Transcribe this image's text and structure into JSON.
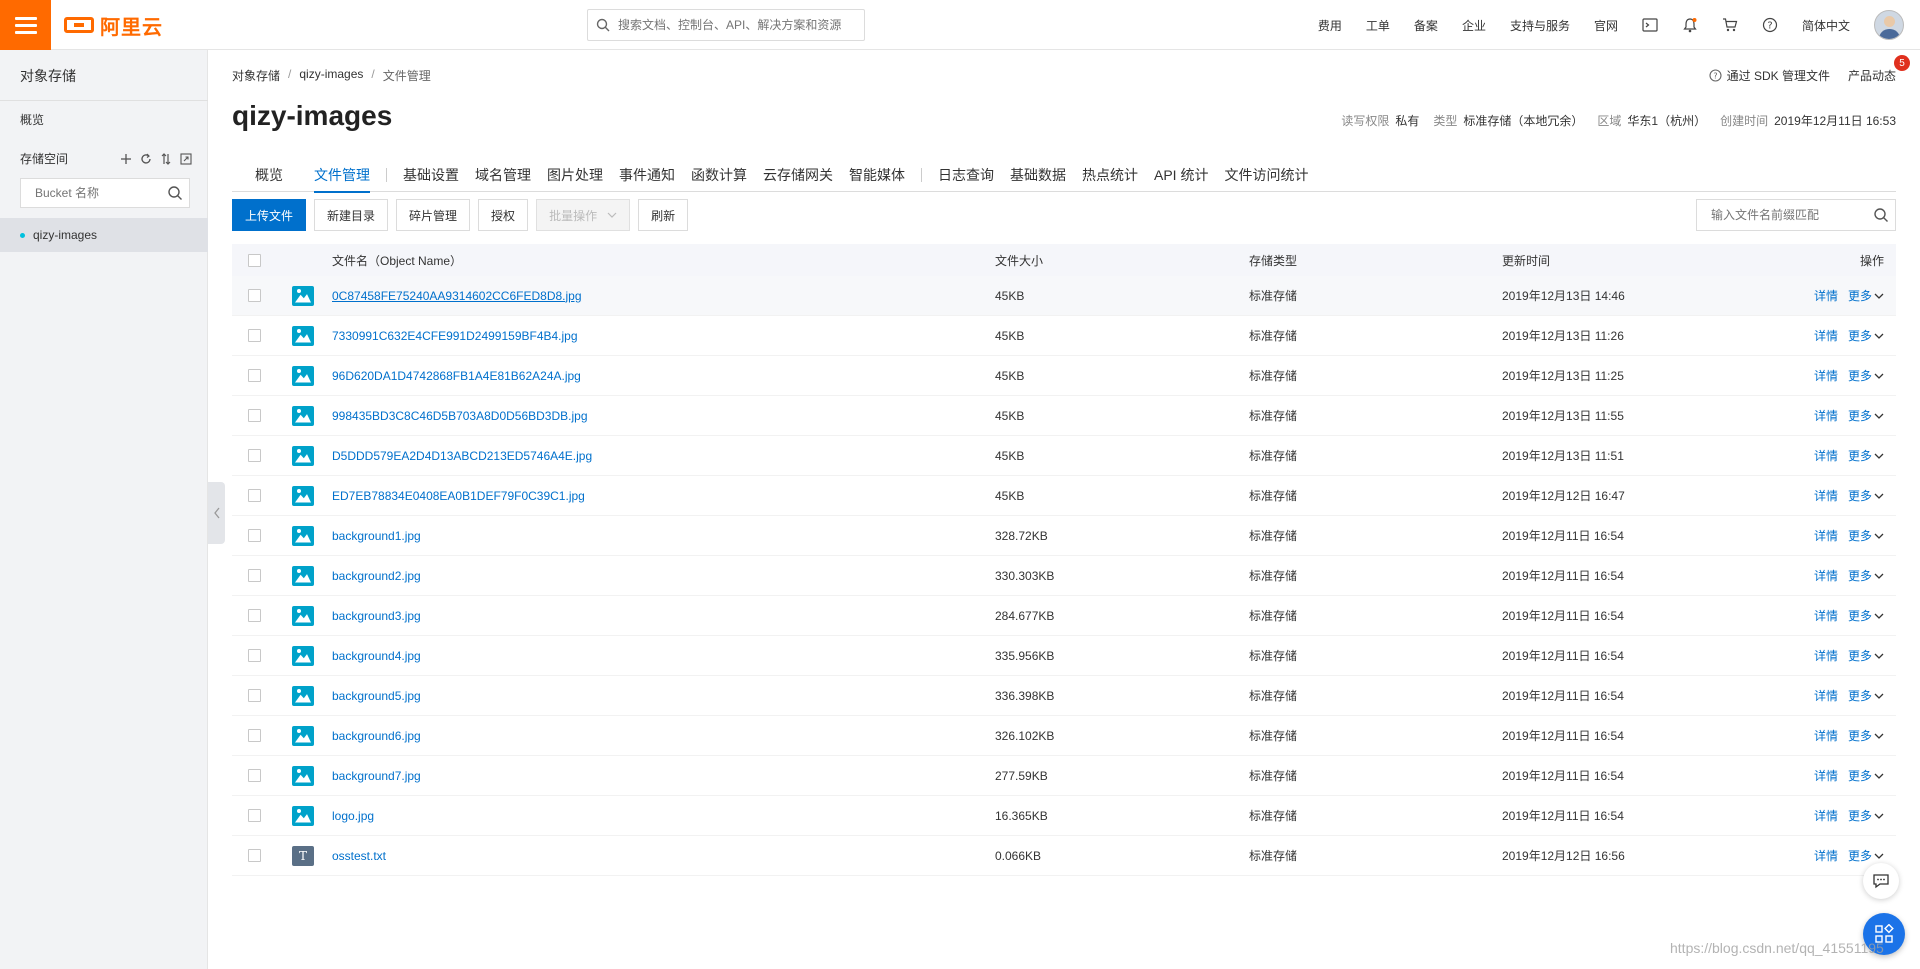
{
  "topbar": {
    "logo_text": "阿里云",
    "search_placeholder": "搜索文档、控制台、API、解决方案和资源",
    "nav": [
      "费用",
      "工单",
      "备案",
      "企业",
      "支持与服务",
      "官网"
    ],
    "language": "简体中文",
    "brand_color": "#ff6a00"
  },
  "sidebar": {
    "title": "对象存储",
    "overview": "概览",
    "buckets_label": "存储空间",
    "bucket_search_placeholder": "Bucket 名称",
    "active_bucket": "qizy-images"
  },
  "breadcrumb": [
    "对象存储",
    "qizy-images",
    "文件管理"
  ],
  "page_title": "qizy-images",
  "header_links": {
    "sdk": "通过 SDK 管理文件",
    "news": "产品动态",
    "news_badge": "5"
  },
  "meta": {
    "acl_label": "读写权限",
    "acl_value": "私有",
    "type_label": "类型",
    "type_value": "标准存储（本地冗余）",
    "region_label": "区域",
    "region_value": "华东1（杭州）",
    "created_label": "创建时间",
    "created_value": "2019年12月11日 16:53"
  },
  "tabs": {
    "overview": "概览",
    "files": "文件管理",
    "group1": [
      "基础设置",
      "域名管理",
      "图片处理",
      "事件通知",
      "函数计算",
      "云存储网关",
      "智能媒体"
    ],
    "group2": [
      "日志查询",
      "基础数据",
      "热点统计",
      "API 统计",
      "文件访问统计"
    ]
  },
  "toolbar": {
    "upload": "上传文件",
    "new_dir": "新建目录",
    "fragments": "碎片管理",
    "authorize": "授权",
    "batch": "批量操作",
    "refresh": "刷新",
    "search_placeholder": "输入文件名前缀匹配"
  },
  "table": {
    "headers": {
      "name": "文件名（Object Name）",
      "size": "文件大小",
      "storage": "存储类型",
      "updated": "更新时间",
      "ops": "操作"
    },
    "op_detail": "详情",
    "op_more": "更多",
    "rows": [
      {
        "name": "0C87458FE75240AA9314602CC6FED8D8.jpg",
        "size": "45KB",
        "storage": "标准存储",
        "updated": "2019年12月13日 14:46",
        "icon": "image-file-icon"
      },
      {
        "name": "7330991C632E4CFE991D2499159BF4B4.jpg",
        "size": "45KB",
        "storage": "标准存储",
        "updated": "2019年12月13日 11:26",
        "icon": "image-file-icon"
      },
      {
        "name": "96D620DA1D4742868FB1A4E81B62A24A.jpg",
        "size": "45KB",
        "storage": "标准存储",
        "updated": "2019年12月13日 11:25",
        "icon": "image-file-icon"
      },
      {
        "name": "998435BD3C8C46D5B703A8D0D56BD3DB.jpg",
        "size": "45KB",
        "storage": "标准存储",
        "updated": "2019年12月13日 11:55",
        "icon": "image-file-icon"
      },
      {
        "name": "D5DDD579EA2D4D13ABCD213ED5746A4E.jpg",
        "size": "45KB",
        "storage": "标准存储",
        "updated": "2019年12月13日 11:51",
        "icon": "image-file-icon"
      },
      {
        "name": "ED7EB78834E0408EA0B1DEF79F0C39C1.jpg",
        "size": "45KB",
        "storage": "标准存储",
        "updated": "2019年12月12日 16:47",
        "icon": "image-file-icon"
      },
      {
        "name": "background1.jpg",
        "size": "328.72KB",
        "storage": "标准存储",
        "updated": "2019年12月11日 16:54",
        "icon": "image-file-icon"
      },
      {
        "name": "background2.jpg",
        "size": "330.303KB",
        "storage": "标准存储",
        "updated": "2019年12月11日 16:54",
        "icon": "image-file-icon"
      },
      {
        "name": "background3.jpg",
        "size": "284.677KB",
        "storage": "标准存储",
        "updated": "2019年12月11日 16:54",
        "icon": "image-file-icon"
      },
      {
        "name": "background4.jpg",
        "size": "335.956KB",
        "storage": "标准存储",
        "updated": "2019年12月11日 16:54",
        "icon": "image-file-icon"
      },
      {
        "name": "background5.jpg",
        "size": "336.398KB",
        "storage": "标准存储",
        "updated": "2019年12月11日 16:54",
        "icon": "image-file-icon"
      },
      {
        "name": "background6.jpg",
        "size": "326.102KB",
        "storage": "标准存储",
        "updated": "2019年12月11日 16:54",
        "icon": "image-file-icon"
      },
      {
        "name": "background7.jpg",
        "size": "277.59KB",
        "storage": "标准存储",
        "updated": "2019年12月11日 16:54",
        "icon": "image-file-icon"
      },
      {
        "name": "logo.jpg",
        "size": "16.365KB",
        "storage": "标准存储",
        "updated": "2019年12月11日 16:54",
        "icon": "image-file-icon"
      },
      {
        "name": "osstest.txt",
        "size": "0.066KB",
        "storage": "标准存储",
        "updated": "2019年12月12日 16:56",
        "icon": "text-file-icon"
      }
    ]
  },
  "watermark": "https://blog.csdn.net/qq_41551195",
  "colors": {
    "accent_blue": "#0070cc",
    "image_icon": "#00a2ca"
  }
}
